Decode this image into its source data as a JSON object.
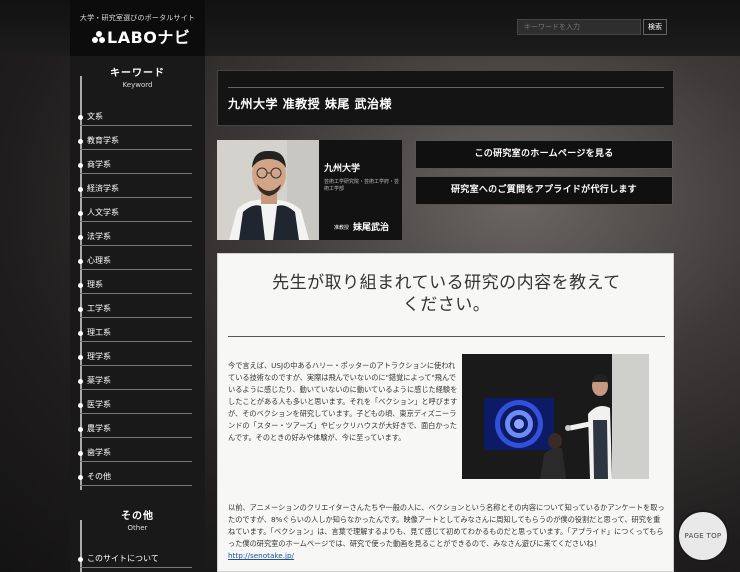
{
  "header": {
    "tagline": "大学・研究室選びのポータルサイト",
    "logo": "LABOナビ",
    "search_placeholder": "キーワードを入力",
    "search_button": "検索"
  },
  "sidebar": {
    "keyword_title": "キーワード",
    "keyword_subtitle": "Keyword",
    "items": [
      "文系",
      "教育学系",
      "商学系",
      "経済学系",
      "人文学系",
      "法学系",
      "心理系",
      "理系",
      "工学系",
      "理工系",
      "理学系",
      "薬学系",
      "医学系",
      "農学系",
      "歯学系",
      "その他"
    ],
    "other_title": "その他",
    "other_subtitle": "Other",
    "other_items": [
      "このサイトについて"
    ]
  },
  "page": {
    "title": "九州大学 准教授 妹尾 武治様"
  },
  "profile": {
    "university": "九州大学",
    "department": "芸術工学研究院・芸術工学府・芸術工学部",
    "rank": "准教授",
    "name": "妹尾武治"
  },
  "actions": {
    "homepage_button": "この研究室のホームページを見る",
    "question_button": "研究室へのご質問をアプライドが代行します"
  },
  "content": {
    "heading_line1": "先生が取り組まれている研究の内容を教えて",
    "heading_line2": "ください。",
    "paragraph1": "今で言えば、USJの中あるハリー・ポッターのアトラクションに使われている技術なのですが、実際は飛んでいないのに\"錯覚によって\"飛んでいるように感じたり、動いていないのに動いているように感じた経験をしたことがある人も多いと思います。それを「ベクション」と呼びますが、そのベクションを研究しています。子どもの頃、東京ディズニーランドの「スター・ツアーズ」やビックリハウスが大好きで、面白かったんです。そのときの好みや体験が、今に至っています。",
    "paragraph2": "以前、アニメーションのクリエイターさんたちや一般の人に、ベクションという名称とその内容について知っているかアンケートを取ったのですが、8%ぐらいの人しか知らなかったんです。映像アートとしてみなさんに周知してもらうのが僕の役割だと思って、研究を重ねています。「ベクション」は、言葉で理解するよりも、見て感じて初めてわかるものだと思っています。「アプライド」につくってもらった僕の研究室のホームページでは、研究で使った動画を見ることができるので、みなさん遊びに来てくださいね！",
    "link": "http://senotake.jp/"
  },
  "page_top": "PAGE TOP"
}
